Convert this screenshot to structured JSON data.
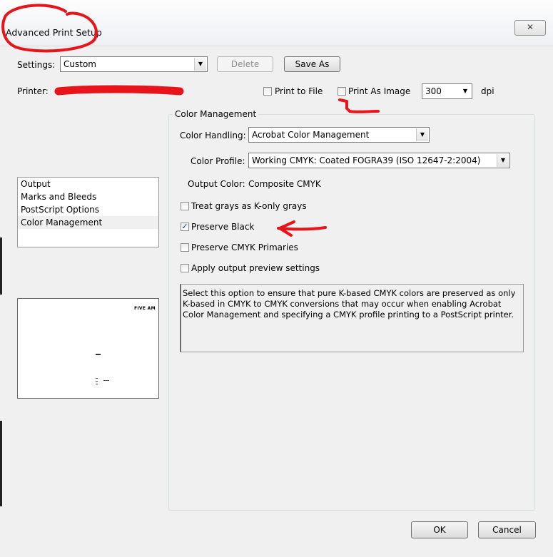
{
  "dialog": {
    "title": "Advanced Print Setup",
    "close_symbol": "✕"
  },
  "settings": {
    "label": "Settings:",
    "value": "Custom",
    "delete_label": "Delete",
    "save_as_label": "Save As"
  },
  "printer": {
    "label": "Printer:",
    "print_to_file_label": "Print to File",
    "print_as_image_label": "Print As Image",
    "print_to_file_checked": false,
    "print_as_image_checked": false,
    "dpi_value": "300",
    "dpi_unit": "dpi"
  },
  "sidebar": {
    "items": [
      {
        "label": "Output",
        "selected": false
      },
      {
        "label": "Marks and Bleeds",
        "selected": false
      },
      {
        "label": "PostScript Options",
        "selected": false
      },
      {
        "label": "Color Management",
        "selected": true
      }
    ]
  },
  "preview": {
    "brand_text": "FIVE AM"
  },
  "color_management": {
    "group_title": "Color Management",
    "color_handling_label": "Color Handling:",
    "color_handling_value": "Acrobat Color Management",
    "color_profile_label": "Color Profile:",
    "color_profile_value": "Working CMYK: Coated FOGRA39 (ISO 12647-2:2004)",
    "output_color_label": "Output Color:",
    "output_color_value": "Composite CMYK",
    "options": [
      {
        "label": "Treat grays as K-only grays",
        "checked": false
      },
      {
        "label": "Preserve Black",
        "checked": true
      },
      {
        "label": "Preserve CMYK Primaries",
        "checked": false
      },
      {
        "label": "Apply output preview settings",
        "checked": false
      }
    ],
    "description": "Select this option to ensure that pure K-based CMYK colors are preserved as only K-based in CMYK to CMYK conversions that may occur when enabling Acrobat Color Management and specifying a CMYK profile printing to a PostScript printer."
  },
  "footer": {
    "ok_label": "OK",
    "cancel_label": "Cancel"
  },
  "annotations": {
    "marker_color": "#e8141b"
  }
}
